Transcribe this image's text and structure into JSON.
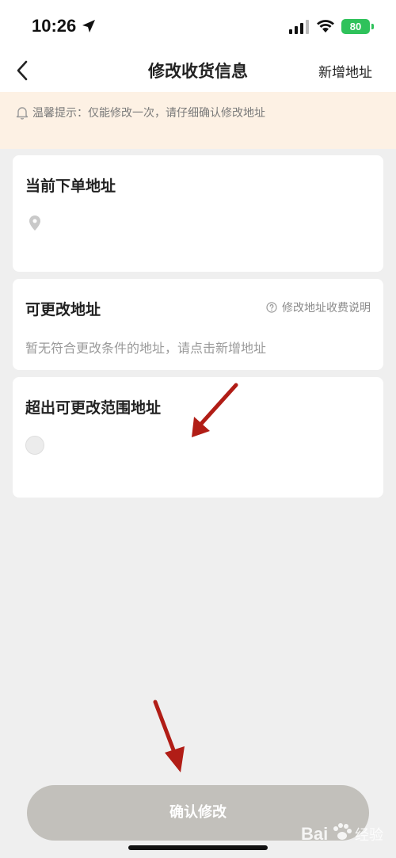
{
  "status_bar": {
    "time": "10:26",
    "battery": "80"
  },
  "nav": {
    "title": "修改收货信息",
    "add_address": "新增地址"
  },
  "notice": {
    "text": "温馨提示：仅能修改一次，请仔细确认修改地址"
  },
  "current_address": {
    "title": "当前下单地址"
  },
  "changeable": {
    "title": "可更改地址",
    "fee_link": "修改地址收费说明",
    "empty_text": "暂无符合更改条件的地址，请点击新增地址"
  },
  "out_of_range": {
    "title": "超出可更改范围地址"
  },
  "confirm": {
    "label": "确认修改"
  },
  "watermark": {
    "text": "Bai经验"
  },
  "colors": {
    "arrow": "#b11d16",
    "notice_bg": "#fdf1e4",
    "button_disabled": "#c2c0bb",
    "battery": "#2fc25b"
  },
  "icons": [
    "location-arrow-icon",
    "signal-icon",
    "wifi-icon",
    "battery-icon",
    "back-icon",
    "bell-icon",
    "location-pin-icon",
    "question-icon",
    "radio-icon",
    "red-arrow-annotation-icon",
    "baidu-paw-icon"
  ]
}
